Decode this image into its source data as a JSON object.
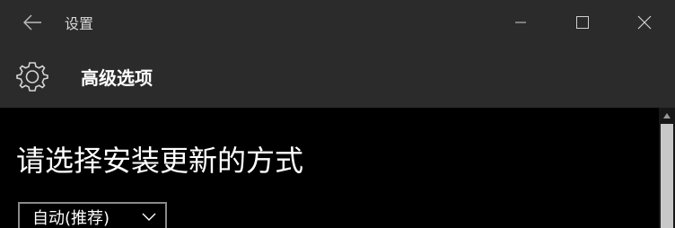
{
  "window": {
    "title": "设置"
  },
  "header": {
    "title": "高级选项"
  },
  "main": {
    "heading": "请选择安装更新的方式",
    "install_mode": {
      "selected": "自动(推荐)"
    }
  }
}
